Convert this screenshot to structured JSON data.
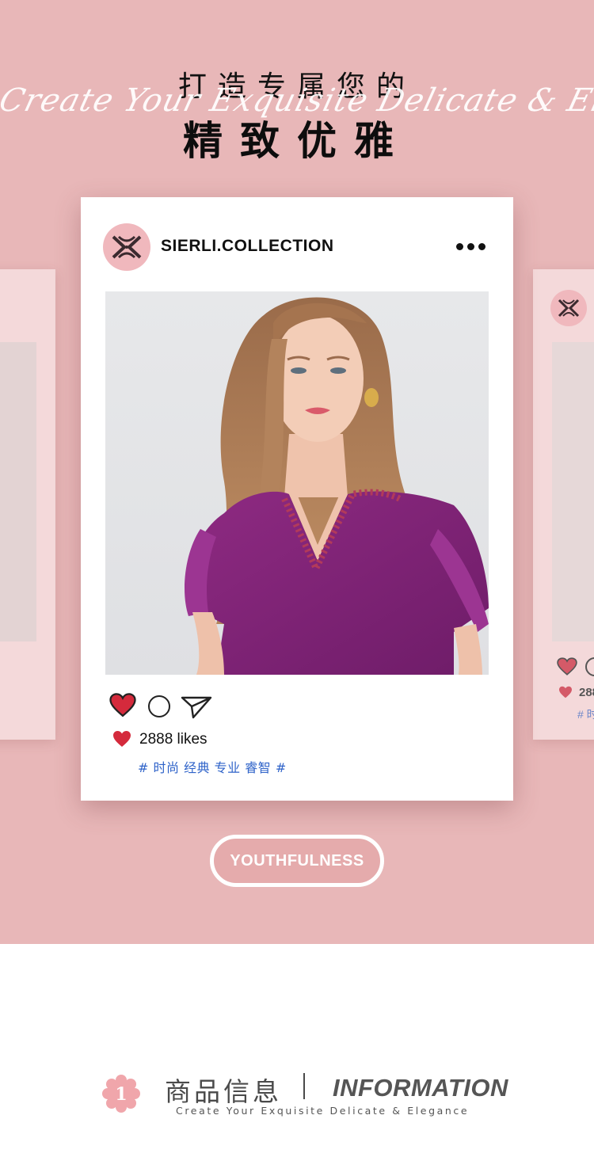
{
  "header": {
    "title_top": "打造专属您的",
    "script_line": "Create Your Exquisite Delicate & Elegance",
    "title_main": "精致优雅"
  },
  "post": {
    "username": "SIERLI.COLLECTION",
    "more_icon": "more-horizontal-icon",
    "photo_subject": "woman-in-purple-top",
    "likes": "2888 likes",
    "hashtags": "# 时尚 经典 专业 睿智 #",
    "action_icons": [
      "heart-icon",
      "comment-icon",
      "send-icon"
    ]
  },
  "side_card": {
    "likes_partial": "288",
    "tag_partial": "# 时"
  },
  "badge": {
    "label": "YOUTHFULNESS"
  },
  "info_section": {
    "number": "1",
    "title_cn": "商品信息",
    "title_en": "INFORMATION",
    "subtitle": "Create Your Exquisite Delicate & Elegance"
  },
  "colors": {
    "hero_bg": "#e8b7b8",
    "avatar_bg": "#f0b8bd",
    "heart_red": "#d42a3c",
    "hashtag_blue": "#2f63c9",
    "pill_bg": "#e5abac"
  }
}
